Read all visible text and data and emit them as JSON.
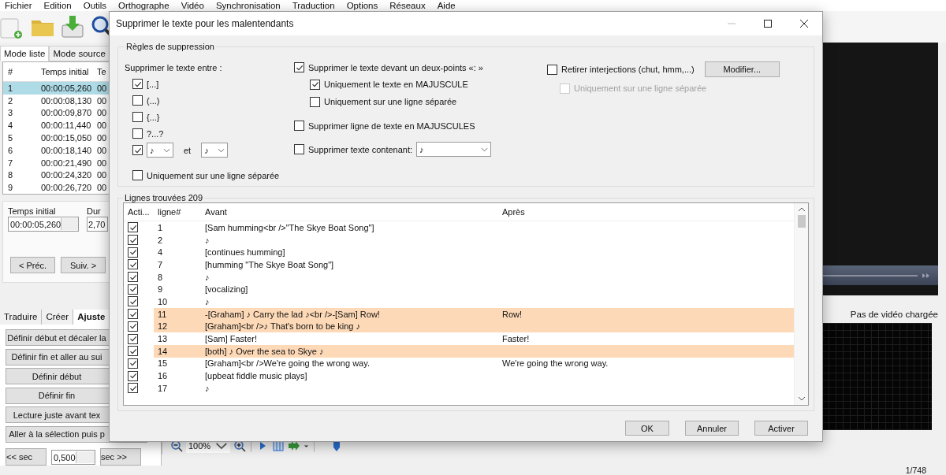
{
  "menu": [
    "Fichier",
    "Edition",
    "Outils",
    "Orthographe",
    "Vidéo",
    "Synchronisation",
    "Traduction",
    "Options",
    "Réseaux",
    "Aide"
  ],
  "main": {
    "view_tabs": [
      {
        "label": "Mode liste",
        "selected": true
      },
      {
        "label": "Mode source",
        "selected": false
      }
    ],
    "subtitle_list": {
      "columns": [
        "#",
        "Temps initial",
        "Te"
      ],
      "rows": [
        {
          "cells": [
            "1",
            "00:00:05,260",
            "00"
          ],
          "selected": true
        },
        {
          "cells": [
            "2",
            "00:00:08,130",
            "00"
          ],
          "selected": false
        },
        {
          "cells": [
            "3",
            "00:00:09,870",
            "00"
          ],
          "selected": false
        },
        {
          "cells": [
            "4",
            "00:00:11,440",
            "00"
          ],
          "selected": false
        },
        {
          "cells": [
            "5",
            "00:00:15,050",
            "00"
          ],
          "selected": false
        },
        {
          "cells": [
            "6",
            "00:00:18,140",
            "00"
          ],
          "selected": false
        },
        {
          "cells": [
            "7",
            "00:00:21,490",
            "00"
          ],
          "selected": false
        },
        {
          "cells": [
            "8",
            "00:00:24,320",
            "00"
          ],
          "selected": false
        },
        {
          "cells": [
            "9",
            "00:00:26,720",
            "00"
          ],
          "selected": false
        }
      ]
    },
    "start_time": {
      "label": "Temps initial",
      "value": "00:00:05,260"
    },
    "duration": {
      "label": "Dur",
      "value": "2,70"
    },
    "nav_buttons": [
      "< Préc.",
      "Suiv. >"
    ],
    "tool_tabs": [
      {
        "label": "Traduire",
        "selected": false
      },
      {
        "label": "Créer",
        "selected": false
      },
      {
        "label": "Ajuste",
        "selected": true
      }
    ],
    "adjust_buttons": [
      "Définir début et décaler la",
      "Définir fin et aller au sui",
      "Définir début",
      "Définir fin",
      "Lecture juste avant tex",
      "Aller à la sélection puis p"
    ],
    "step": {
      "back": "<< sec",
      "value": "0,500",
      "forward": "sec >>"
    }
  },
  "video": {
    "status": "Pas de vidéo chargée"
  },
  "waveform_toolbar": {
    "zoom": "100%"
  },
  "status_bar": {
    "position": "1/748"
  },
  "dialog": {
    "title": "Supprimer le texte pour les malentendants",
    "rules": {
      "title": "Règles de suppression",
      "between": {
        "label": "Supprimer le texte entre :",
        "options": [
          {
            "label": "[...]",
            "checked": true
          },
          {
            "label": "(...)",
            "checked": false
          },
          {
            "label": "{...}",
            "checked": false
          },
          {
            "label": "?...?",
            "checked": false
          }
        ],
        "custom": {
          "checked": true,
          "start": "♪",
          "joiner": "et",
          "end": "♪"
        },
        "separate_line": {
          "label": "Uniquement sur une ligne séparée",
          "checked": false
        }
      },
      "colon": {
        "label": "Supprimer le texte devant un deux-points «: »",
        "checked": true,
        "options": [
          {
            "label": "Uniquement le texte en MAJUSCULE",
            "checked": true
          },
          {
            "label": "Uniquement sur une ligne séparée",
            "checked": false
          }
        ]
      },
      "uppercase_lines": {
        "label": "Supprimer ligne de texte en MAJUSCULES",
        "checked": false
      },
      "containing": {
        "label": "Supprimer texte contenant:",
        "checked": false,
        "value": "♪"
      },
      "interjections": {
        "label": "Retirer interjections (chut, hmm,...)",
        "checked": false,
        "button": "Modifier...",
        "separate_line": {
          "label": "Uniquement sur une ligne séparée",
          "checked": false,
          "disabled": true
        }
      }
    },
    "found": {
      "title": "Lignes trouvées 209",
      "columns": [
        "Acti...",
        "ligne#",
        "Avant",
        "Après"
      ],
      "rows": [
        {
          "active": true,
          "line": "1",
          "before": "[Sam humming<br />\"The Skye Boat Song\"]",
          "highlighted": false
        },
        {
          "active": true,
          "line": "2",
          "before": "♪",
          "highlighted": false
        },
        {
          "active": true,
          "line": "4",
          "before": "[continues humming]",
          "highlighted": false
        },
        {
          "active": true,
          "line": "7",
          "before": "[humming \"The Skye Boat Song\"]",
          "highlighted": false
        },
        {
          "active": true,
          "line": "8",
          "before": "♪",
          "highlighted": false
        },
        {
          "active": true,
          "line": "9",
          "before": "[vocalizing]",
          "highlighted": false
        },
        {
          "active": true,
          "line": "10",
          "before": "♪",
          "highlighted": false
        },
        {
          "active": true,
          "line": "11",
          "before": "-[Graham] ♪ Carry the lad ♪<br />-[Sam] Row!",
          "after": "Row!",
          "highlighted": true
        },
        {
          "active": true,
          "line": "12",
          "before": "[Graham]<br />♪ That's born to be king ♪",
          "highlighted": true
        },
        {
          "active": true,
          "line": "13",
          "before": "[Sam] Faster!",
          "after": "Faster!",
          "highlighted": false
        },
        {
          "active": true,
          "line": "14",
          "before": "[both] ♪ Over the sea to Skye ♪",
          "highlighted": true
        },
        {
          "active": true,
          "line": "15",
          "before": "[Graham]<br />We're going the wrong way.",
          "after": "We're going the wrong way.",
          "highlighted": false
        },
        {
          "active": true,
          "line": "16",
          "before": "[upbeat fiddle music plays]",
          "highlighted": false
        },
        {
          "active": true,
          "line": "17",
          "before": "♪",
          "highlighted": false
        }
      ]
    },
    "buttons": [
      "OK",
      "Annuler",
      "Activer"
    ]
  }
}
